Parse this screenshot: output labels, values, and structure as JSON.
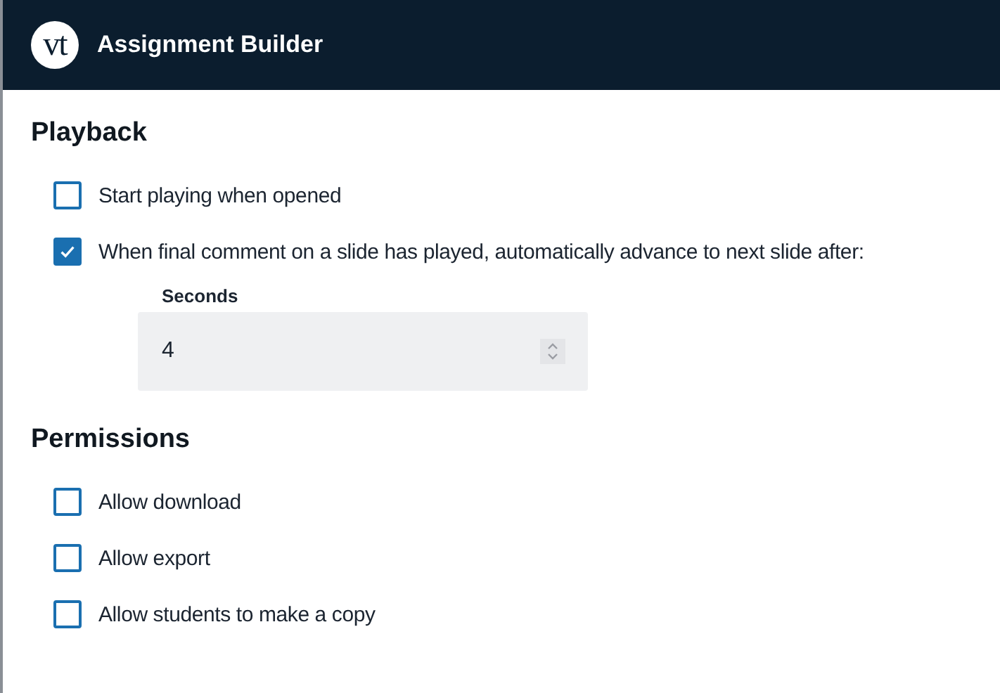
{
  "header": {
    "logo_text": "vt",
    "title": "Assignment Builder"
  },
  "sections": [
    {
      "title": "Playback",
      "options": [
        {
          "label": "Start playing when opened",
          "checked": false
        },
        {
          "label": "When final comment on a slide has played, automatically advance to next slide after:",
          "checked": true,
          "field": {
            "label": "Seconds",
            "value": "4"
          }
        }
      ]
    },
    {
      "title": "Permissions",
      "options": [
        {
          "label": "Allow download",
          "checked": false
        },
        {
          "label": "Allow export",
          "checked": false
        },
        {
          "label": "Allow students to make a copy",
          "checked": false
        }
      ]
    }
  ]
}
